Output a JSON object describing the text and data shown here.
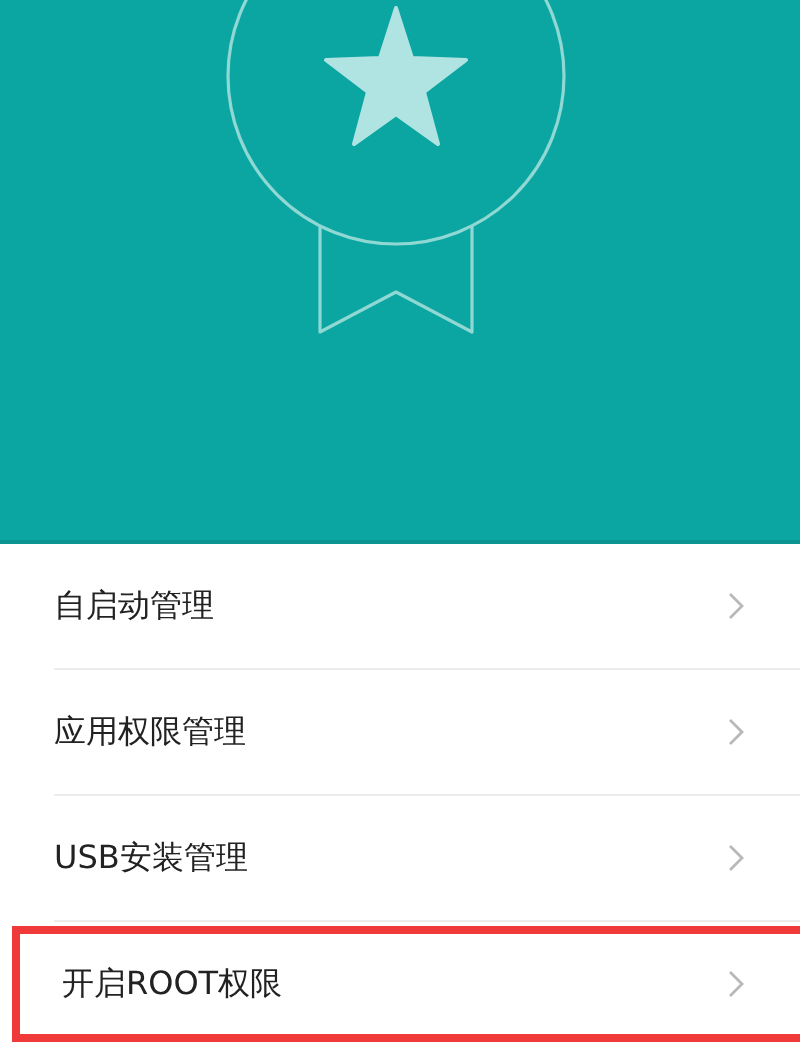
{
  "header": {
    "kind": "medal"
  },
  "items": [
    {
      "label": "自启动管理",
      "highlighted": false
    },
    {
      "label": "应用权限管理",
      "highlighted": false
    },
    {
      "label": "USB安装管理",
      "highlighted": false
    },
    {
      "label": "开启ROOT权限",
      "highlighted": true
    }
  ]
}
